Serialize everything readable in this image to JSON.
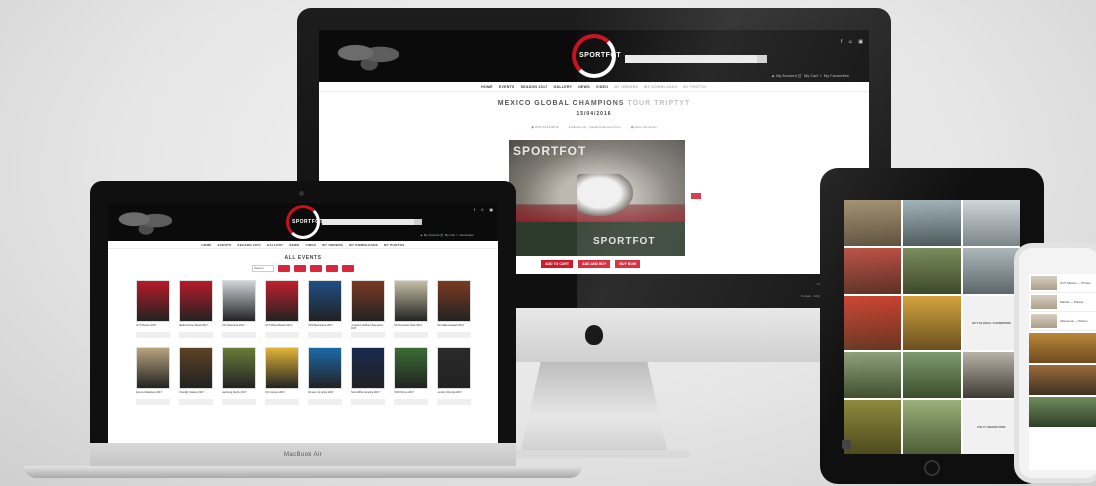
{
  "brand": {
    "logo_text": "SPORTFOT",
    "watermark": "SPORTFOT",
    "accent": "#d11a2d"
  },
  "imac": {
    "social_icons": "f ☺ ▣",
    "header_links": "▲ My Account  🛒 My Cart  ☆ My Favourites",
    "nav": [
      "HOME",
      "EVENTS",
      "SEASON 2017",
      "GALLERY",
      "NEWS",
      "VIDEO",
      "MY ORDERS",
      "MY DOWNLOADS",
      "MY PHOTOS"
    ],
    "event_title_dark": "MEXICO GLOBAL CHAMPIONS",
    "event_title_light": "TOUR TRIPTYT",
    "event_date": "15/04/2016",
    "meta": [
      "▣ 2017-04-15 08:10",
      "● Mexico City · Global Champions Tour",
      "▣ Add to favourites"
    ],
    "cta": [
      "ADD TO CART",
      "ADD AND BUY",
      "BUY NOW"
    ],
    "footer_line1": "COPYRIGHT SPORTFOT 2017",
    "footer_line2": "Contact · FAQ · Terms of Use · Legal notice"
  },
  "macbook": {
    "label": "MacBook Air",
    "social_icons": "f ☺ ▣",
    "header_links": "▲ My Account  🛒 My Cart  ☆ Favourites",
    "nav": [
      "HOME",
      "EVENTS",
      "SEASON 2017",
      "GALLERY",
      "NEWS",
      "VIDEO",
      "MY ORDERS",
      "MY DOWNLOADS",
      "MY PHOTOS"
    ],
    "all_events": "ALL EVENTS",
    "filter_label": "Season",
    "events": [
      {
        "title": "GCT Mexico 2017",
        "color": "#b71a2a"
      },
      {
        "title": "Madrid Horse Week 2017",
        "color": "#b71a2a"
      },
      {
        "title": "CSI Vilamoura 2017",
        "color": "#cfd4d8"
      },
      {
        "title": "GCT Miami Beach 2017",
        "color": "#c01f2d"
      },
      {
        "title": "CSIO Barcelona 2017",
        "color": "#1f4f86"
      },
      {
        "title": "Longines Global Champions 2017",
        "color": "#7a3a22"
      },
      {
        "title": "CSI Sentower Park 2017",
        "color": "#c5bfa6"
      },
      {
        "title": "CSI Valkenswaard 2017",
        "color": "#7a3a22"
      },
      {
        "title": "Spruce Meadows 2017",
        "color": "#b8a37d"
      },
      {
        "title": "Chantilly Classic 2017",
        "color": "#5c4226"
      },
      {
        "title": "Hamburg Derby 2017",
        "color": "#6a7c3a"
      },
      {
        "title": "CSI Cannes 2017",
        "color": "#e0b437"
      },
      {
        "title": "Monaco Jumping 2017",
        "color": "#1b6aa7"
      },
      {
        "title": "Paris Eiffel Jumping 2017",
        "color": "#182a4f"
      },
      {
        "title": "CSIO Rome 2017",
        "color": "#3b6d34"
      },
      {
        "title": "London Olympia 2017",
        "color": "#2a2a2a"
      }
    ]
  },
  "ipad": {
    "captions": [
      "GCT GLOBAL CHAMPIONS",
      "CSI 5* GRAND PRIX"
    ]
  },
  "iphone": {
    "rows": [
      "GCT Mexico — Photos",
      "Madrid — Photos",
      "Vilamoura — Photos"
    ]
  }
}
